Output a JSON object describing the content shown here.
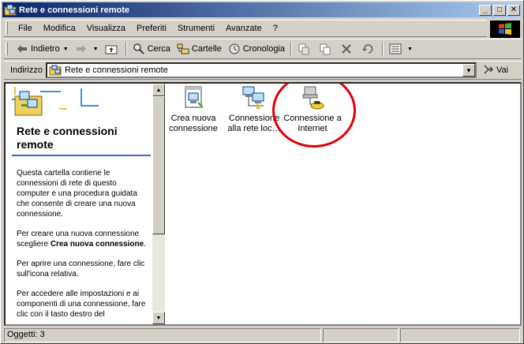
{
  "window": {
    "title": "Rete e connessioni remote",
    "controls": {
      "minimize": "_",
      "maximize": "□",
      "close": "✕"
    }
  },
  "menubar": {
    "items": [
      "File",
      "Modifica",
      "Visualizza",
      "Preferiti",
      "Strumenti",
      "Avanzate",
      "?"
    ]
  },
  "toolbar": {
    "back": "Indietro",
    "search": "Cerca",
    "folders": "Cartelle",
    "history": "Cronologia"
  },
  "address": {
    "label": "Indirizzo",
    "value": "Rete e connessioni remote",
    "go": "Vai"
  },
  "leftpane": {
    "title": "Rete e connessioni remote",
    "para1": "Questa cartella contiene le connessioni di rete di questo computer e una procedura guidata che consente di creare una nuova connessione.",
    "para2_pre": "Per creare una nuova connessione scegliere ",
    "para2_bold": "Crea nuova connessione",
    "para2_post": ".",
    "para3": "Per aprire una connessione, fare clic sull'icona relativa.",
    "para4": "Per accedere alle impostazioni e ai componenti di una connessione, fare clic con il tasto destro del"
  },
  "icons": [
    {
      "label": "Crea nuova connessione",
      "icon": "new-connection-icon"
    },
    {
      "label": "Connessione alla rete loc…",
      "icon": "lan-connection-icon"
    },
    {
      "label": "Connessione a Internet",
      "icon": "dialup-connection-icon"
    }
  ],
  "statusbar": {
    "text": "Oggetti: 3"
  },
  "colors": {
    "title_start": "#0a246a",
    "title_end": "#a6caf0",
    "highlight_circle": "#e00000"
  }
}
